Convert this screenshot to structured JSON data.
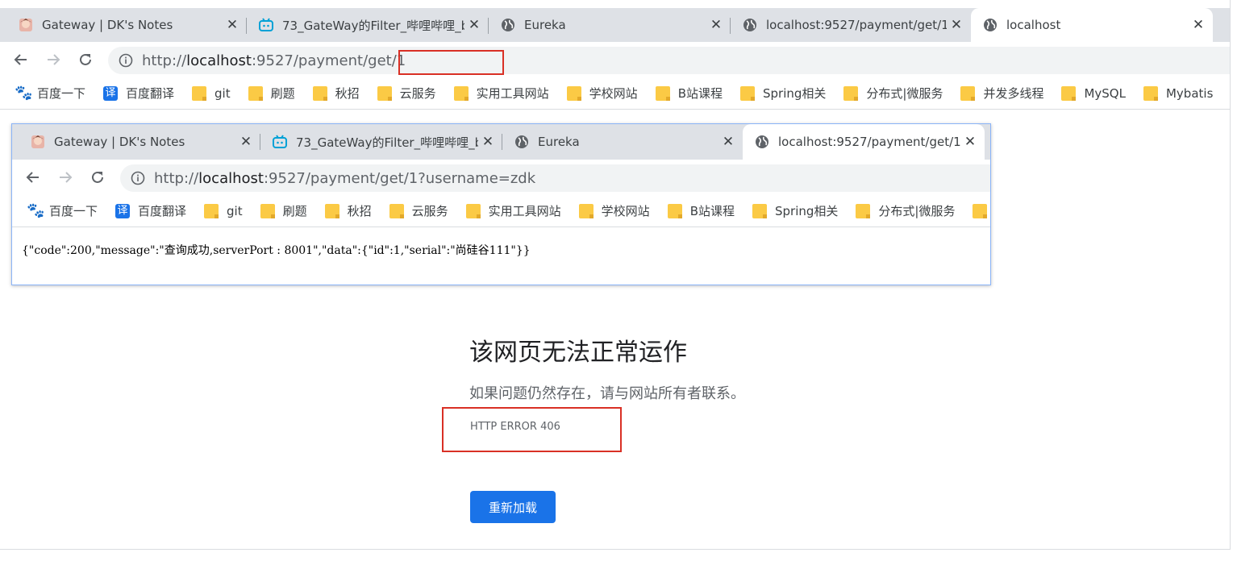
{
  "outer": {
    "tabs": [
      {
        "title": "Gateway | DK's Notes",
        "icon": "anime-avatar-icon"
      },
      {
        "title": "73_GateWay的Filter_哔哩哔哩_b",
        "icon": "bilibili-icon"
      },
      {
        "title": "Eureka",
        "icon": "globe-icon"
      },
      {
        "title": "localhost:9527/payment/get/1",
        "icon": "globe-icon"
      },
      {
        "title": "localhost",
        "icon": "globe-icon",
        "active": true
      }
    ],
    "url_prefix": "http://",
    "url_host": "localhost",
    "url_rest": ":9527/payment/get/1"
  },
  "bookmarks": [
    {
      "label": "百度一下",
      "icon": "baidu-icon"
    },
    {
      "label": "百度翻译",
      "icon": "translate-icon",
      "glyph": "译"
    },
    {
      "label": "git",
      "icon": "folder-icon"
    },
    {
      "label": "刷题",
      "icon": "folder-icon"
    },
    {
      "label": "秋招",
      "icon": "folder-icon"
    },
    {
      "label": "云服务",
      "icon": "folder-icon"
    },
    {
      "label": "实用工具网站",
      "icon": "folder-icon"
    },
    {
      "label": "学校网站",
      "icon": "folder-icon"
    },
    {
      "label": "B站课程",
      "icon": "folder-icon"
    },
    {
      "label": "Spring相关",
      "icon": "folder-icon"
    },
    {
      "label": "分布式|微服务",
      "icon": "folder-icon"
    },
    {
      "label": "并发多线程",
      "icon": "folder-icon"
    },
    {
      "label": "MySQL",
      "icon": "folder-icon"
    },
    {
      "label": "Mybatis",
      "icon": "folder-icon"
    }
  ],
  "inner": {
    "tabs": [
      {
        "title": "Gateway | DK's Notes",
        "icon": "anime-avatar-icon"
      },
      {
        "title": "73_GateWay的Filter_哔哩哔哩_b",
        "icon": "bilibili-icon"
      },
      {
        "title": "Eureka",
        "icon": "globe-icon"
      },
      {
        "title": "localhost:9527/payment/get/1",
        "icon": "globe-icon",
        "active": true
      }
    ],
    "url_prefix": "http://",
    "url_host": "localhost",
    "url_rest": ":9527/payment/get/1?username=zdk",
    "json_text": "{\"code\":200,\"message\":\"查询成功,serverPort : 8001\",\"data\":{\"id\":1,\"serial\":\"尚硅谷111\"}}"
  },
  "error_page": {
    "title": "该网页无法正常运作",
    "subtitle": "如果问题仍然存在，请与网站所有者联系。",
    "code": "HTTP ERROR 406",
    "reload_label": "重新加载"
  },
  "colors": {
    "highlight": "#d93025",
    "accent": "#1a73e8",
    "tabstrip": "#dee1e6"
  }
}
